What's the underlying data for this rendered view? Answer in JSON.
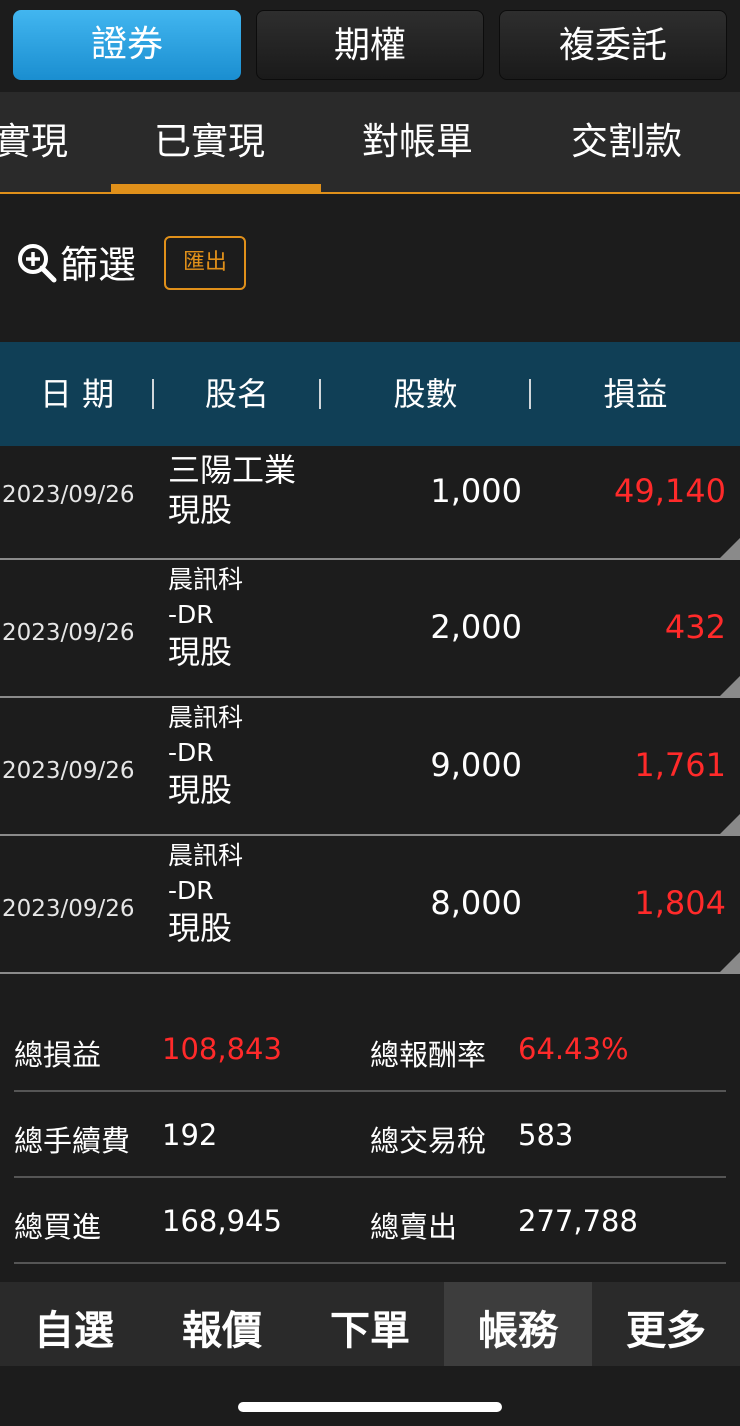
{
  "top_tabs": [
    {
      "label": "證券",
      "active": true
    },
    {
      "label": "期權",
      "active": false
    },
    {
      "label": "複委託",
      "active": false
    }
  ],
  "sub_tabs": [
    {
      "label": "實現"
    },
    {
      "label": "已實現",
      "active": true
    },
    {
      "label": "對帳單"
    },
    {
      "label": "交割款"
    }
  ],
  "filter": {
    "label": "篩選",
    "export_label": "匯出"
  },
  "table": {
    "headers": [
      "日 期",
      "股名",
      "股數",
      "損益"
    ],
    "rows": [
      {
        "date": "2023/09/26",
        "name_lines": [
          "三陽工業",
          "現股"
        ],
        "qty": "1,000",
        "pnl": "49,140"
      },
      {
        "date": "2023/09/26",
        "name_lines": [
          "晨訊科",
          "-DR",
          "現股"
        ],
        "qty": "2,000",
        "pnl": "432"
      },
      {
        "date": "2023/09/26",
        "name_lines": [
          "晨訊科",
          "-DR",
          "現股"
        ],
        "qty": "9,000",
        "pnl": "1,761"
      },
      {
        "date": "2023/09/26",
        "name_lines": [
          "晨訊科",
          "-DR",
          "現股"
        ],
        "qty": "8,000",
        "pnl": "1,804"
      }
    ]
  },
  "summary": {
    "total_pnl_label": "總損益",
    "total_pnl": "108,843",
    "total_return_label": "總報酬率",
    "total_return": "64.43%",
    "total_fee_label": "總手續費",
    "total_fee": "192",
    "total_tax_label": "總交易稅",
    "total_tax": "583",
    "total_buy_label": "總買進",
    "total_buy": "168,945",
    "total_sell_label": "總賣出",
    "total_sell": "277,788"
  },
  "bottom_nav": [
    {
      "label": "自選"
    },
    {
      "label": "報價"
    },
    {
      "label": "下單"
    },
    {
      "label": "帳務",
      "active": true
    },
    {
      "label": "更多"
    }
  ],
  "colors": {
    "accent": "#e0901a",
    "active_tab": "#2aa2e2",
    "header_bg": "#103f56",
    "loss_profit_red": "#ff2a2a"
  }
}
